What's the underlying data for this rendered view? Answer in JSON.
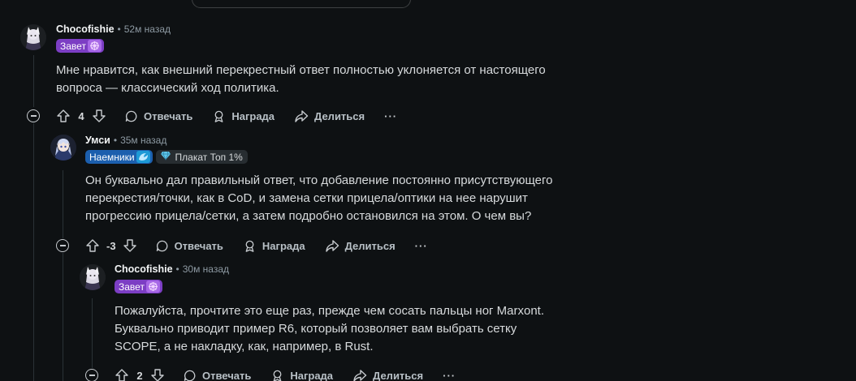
{
  "comments": [
    {
      "author": "Chocofishie",
      "time": "52м назад",
      "flairs": [
        "Завет"
      ],
      "body_lines": [
        "Мне нравится, как внешний перекрестный ответ полностью уклоняется от настоящего",
        "вопроса — классический ход политика."
      ],
      "score": "4",
      "reply_label": "Отвечать",
      "award_label": "Награда",
      "share_label": "Делиться"
    },
    {
      "author": "Умси",
      "time": "35м назад",
      "flairs": [
        "Наемники",
        "Плакат Топ 1%"
      ],
      "body_lines": [
        "Он буквально дал правильный ответ, что добавление постоянно присутствующего",
        "перекрестия/точки, как в CoD, и замена сетки прицела/оптики на нее нарушит",
        "прогрессию прицела/сетки, а затем подробно остановился на этом. О чем вы?"
      ],
      "score": "-3",
      "reply_label": "Отвечать",
      "award_label": "Награда",
      "share_label": "Делиться"
    },
    {
      "author": "Chocofishie",
      "time": "30м назад",
      "flairs": [
        "Завет"
      ],
      "body_lines": [
        "Пожалуйста, прочтите это еще раз, прежде чем сосать пальцы ног Marxont.",
        "Буквально приводит пример R6, который позволяет вам выбрать сетку",
        "SCOPE, а не накладку, как, например, в Rust."
      ],
      "score": "2",
      "reply_label": "Отвечать",
      "award_label": "Награда",
      "share_label": "Делиться"
    }
  ],
  "separator": "•",
  "more_label": "···",
  "colors": {
    "background": "#0e1113",
    "flair_purple": "#7c3ec4",
    "flair_blue": "#1c5fae",
    "thread_line": "#2a3236"
  }
}
